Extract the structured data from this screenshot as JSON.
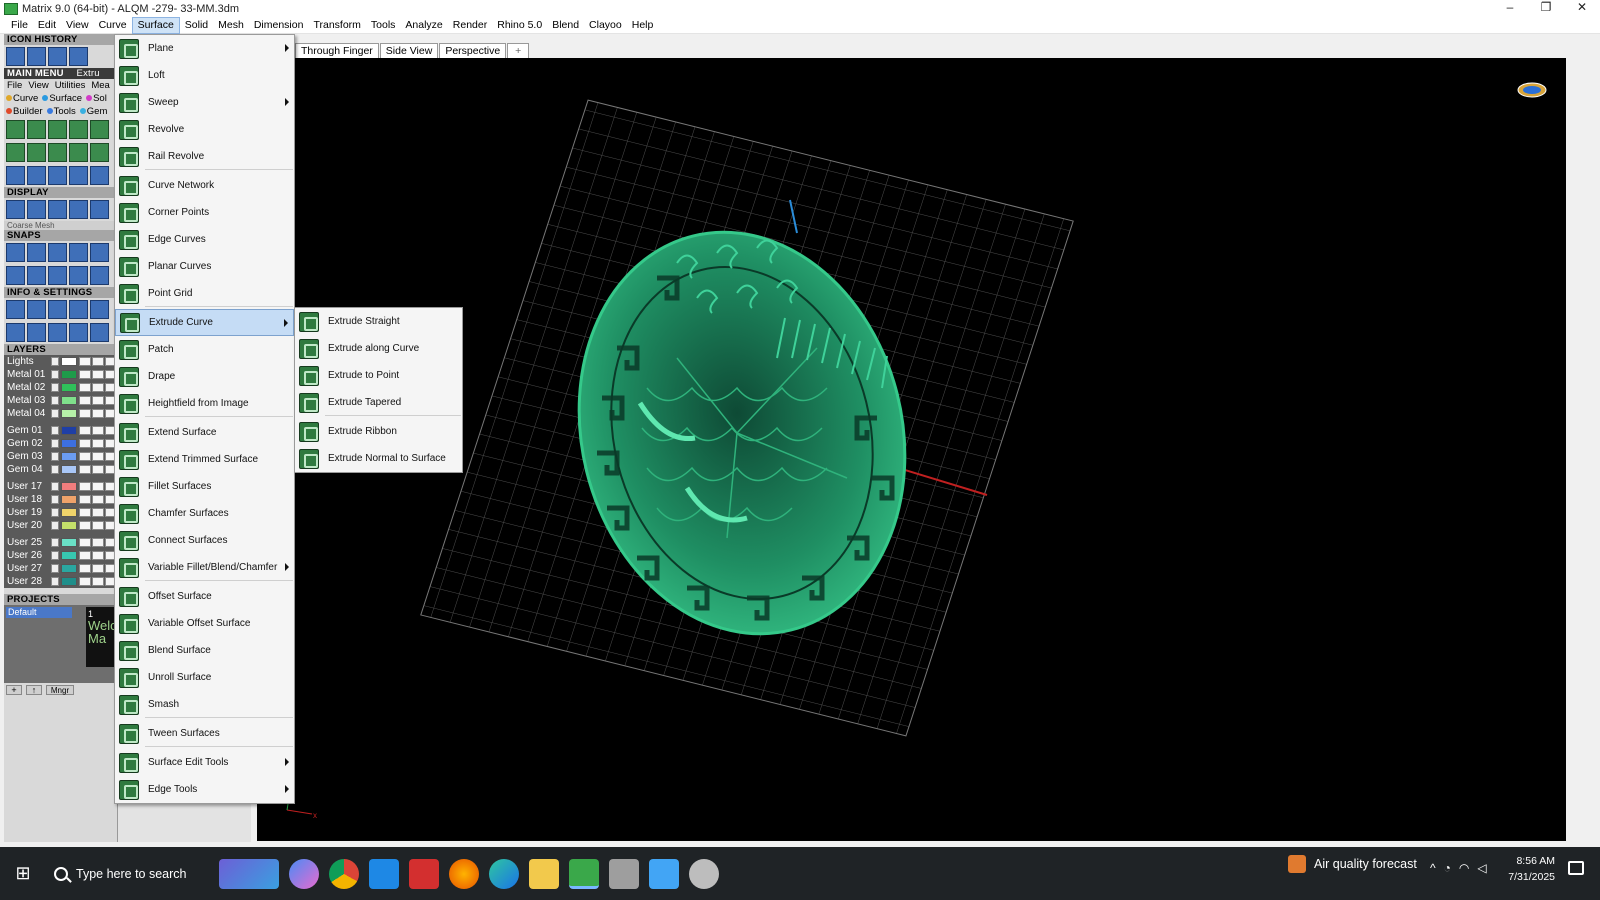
{
  "window": {
    "title": "Matrix 9.0 (64-bit) - ALQM -279- 33-MM.3dm",
    "controls": [
      "–",
      "❐",
      "✕"
    ]
  },
  "menubar": [
    "File",
    "Edit",
    "View",
    "Curve",
    "Surface",
    "Solid",
    "Mesh",
    "Dimension",
    "Transform",
    "Tools",
    "Analyze",
    "Render",
    "Rhino 5.0",
    "Blend",
    "Clayoo",
    "Help"
  ],
  "left_panel": {
    "icon_history": "ICON HISTORY",
    "main_menu": "MAIN MENU",
    "main_menu_extra": "Extru",
    "menu_row": [
      "File",
      "View",
      "Utilities",
      "Mea"
    ],
    "tabs_row1": [
      "Curve",
      "Surface",
      "Sol"
    ],
    "tabs_row2": [
      "Builder",
      "Tools",
      "Gem"
    ],
    "display": "DISPLAY",
    "coarse_mesh": "Coarse Mesh",
    "snaps": "SNAPS",
    "info_settings": "INFO & SETTINGS",
    "layers": "LAYERS",
    "layer_list": [
      {
        "name": "Lights",
        "color": "#ffffff"
      },
      {
        "name": "Metal 01",
        "color": "#1e9b4a"
      },
      {
        "name": "Metal 02",
        "color": "#2fc15a"
      },
      {
        "name": "Metal 03",
        "color": "#7fe08b"
      },
      {
        "name": "Metal 04",
        "color": "#b6f0a8"
      },
      {
        "name": "Gem 01",
        "color": "#1f3fa6"
      },
      {
        "name": "Gem 02",
        "color": "#3d6fe0"
      },
      {
        "name": "Gem 03",
        "color": "#6b9cf2"
      },
      {
        "name": "Gem 04",
        "color": "#a9c7f7"
      },
      {
        "name": "User 17",
        "color": "#f07d7d"
      },
      {
        "name": "User 18",
        "color": "#f0a36a"
      },
      {
        "name": "User 19",
        "color": "#f0d36a"
      },
      {
        "name": "User 20",
        "color": "#c4e06a"
      },
      {
        "name": "User 25",
        "color": "#6ae0c6"
      },
      {
        "name": "User 26",
        "color": "#37c7b0"
      },
      {
        "name": "User 27",
        "color": "#2aa7a0"
      },
      {
        "name": "User 28",
        "color": "#1f8e8a"
      }
    ],
    "projects": "PROJECTS",
    "project_default": "Default",
    "project_thumb_number": "1",
    "project_thumb_text": "Welc Ma",
    "mgr_button": "Mngr"
  },
  "viewport_tabs": [
    "Through Finger",
    "Side View",
    "Perspective",
    "+"
  ],
  "surface_menu": [
    {
      "label": "Plane",
      "submenu": true
    },
    {
      "label": "Loft",
      "submenu": false
    },
    {
      "label": "Sweep",
      "submenu": true
    },
    {
      "label": "Revolve",
      "submenu": false
    },
    {
      "label": "Rail Revolve",
      "submenu": false
    },
    {
      "label": "Curve Network",
      "submenu": false
    },
    {
      "label": "Corner Points",
      "submenu": false
    },
    {
      "label": "Edge Curves",
      "submenu": false
    },
    {
      "label": "Planar Curves",
      "submenu": false
    },
    {
      "label": "Point Grid",
      "submenu": false
    },
    {
      "label": "Extrude Curve",
      "submenu": true,
      "highlighted": true
    },
    {
      "label": "Patch",
      "submenu": false
    },
    {
      "label": "Drape",
      "submenu": false
    },
    {
      "label": "Heightfield from Image",
      "submenu": false
    },
    {
      "label": "Extend Surface",
      "submenu": false
    },
    {
      "label": "Extend Trimmed Surface",
      "submenu": false
    },
    {
      "label": "Fillet Surfaces",
      "submenu": false
    },
    {
      "label": "Chamfer Surfaces",
      "submenu": false
    },
    {
      "label": "Connect Surfaces",
      "submenu": false
    },
    {
      "label": "Variable Fillet/Blend/Chamfer",
      "submenu": true
    },
    {
      "label": "Offset Surface",
      "submenu": false
    },
    {
      "label": "Variable Offset Surface",
      "submenu": false
    },
    {
      "label": "Blend Surface",
      "submenu": false
    },
    {
      "label": "Unroll Surface",
      "submenu": false
    },
    {
      "label": "Smash",
      "submenu": false
    },
    {
      "label": "Tween Surfaces",
      "submenu": false
    },
    {
      "label": "Surface Edit Tools",
      "submenu": true
    },
    {
      "label": "Edge Tools",
      "submenu": true
    }
  ],
  "extrude_submenu": [
    "Extrude Straight",
    "Extrude along Curve",
    "Extrude to Point",
    "Extrude Tapered",
    "Extrude Ribbon",
    "Extrude Normal to Surface"
  ],
  "taskbar": {
    "search_placeholder": "Type here to search",
    "weather": "Air quality forecast",
    "time": "8:56 AM",
    "date": "7/31/2025"
  },
  "colors": {
    "model_green": "#1f8f63",
    "viewport_bg": "#000000",
    "grid": "#5a5a5a",
    "menu_highlight": "#c5dcf5"
  }
}
